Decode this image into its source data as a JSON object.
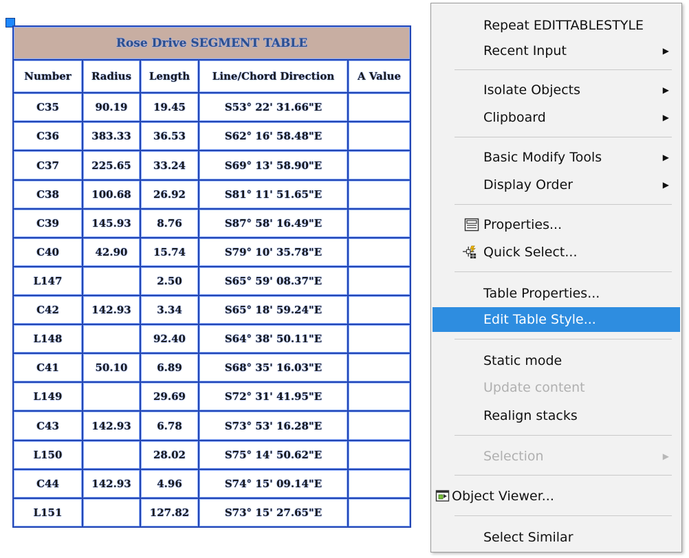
{
  "table": {
    "title": "Rose Drive SEGMENT TABLE",
    "headers": [
      "Number",
      "Radius",
      "Length",
      "Line/Chord Direction",
      "A Value"
    ],
    "rows": [
      [
        "C35",
        "90.19",
        "19.45",
        "S53° 22' 31.66\"E",
        ""
      ],
      [
        "C36",
        "383.33",
        "36.53",
        "S62° 16' 58.48\"E",
        ""
      ],
      [
        "C37",
        "225.65",
        "33.24",
        "S69° 13' 58.90\"E",
        ""
      ],
      [
        "C38",
        "100.68",
        "26.92",
        "S81° 11' 51.65\"E",
        ""
      ],
      [
        "C39",
        "145.93",
        "8.76",
        "S87° 58' 16.49\"E",
        ""
      ],
      [
        "C40",
        "42.90",
        "15.74",
        "S79° 10' 35.78\"E",
        ""
      ],
      [
        "L147",
        "",
        "2.50",
        "S65° 59' 08.37\"E",
        ""
      ],
      [
        "C42",
        "142.93",
        "3.34",
        "S65° 18' 59.24\"E",
        ""
      ],
      [
        "L148",
        "",
        "92.40",
        "S64° 38' 50.11\"E",
        ""
      ],
      [
        "C41",
        "50.10",
        "6.89",
        "S68° 35' 16.03\"E",
        ""
      ],
      [
        "L149",
        "",
        "29.69",
        "S72° 31' 41.95\"E",
        ""
      ],
      [
        "C43",
        "142.93",
        "6.78",
        "S73° 53' 16.28\"E",
        ""
      ],
      [
        "L150",
        "",
        "28.02",
        "S75° 14' 50.62\"E",
        ""
      ],
      [
        "C44",
        "142.93",
        "4.96",
        "S74° 15' 09.14\"E",
        ""
      ],
      [
        "L151",
        "",
        "127.82",
        "S73° 15' 27.65\"E",
        ""
      ]
    ]
  },
  "menu": {
    "repeat": "Repeat EDITTABLESTYLE",
    "recent_input": "Recent Input",
    "isolate_objects": "Isolate Objects",
    "clipboard": "Clipboard",
    "basic_modify_tools": "Basic Modify Tools",
    "display_order": "Display Order",
    "properties": "Properties...",
    "quick_select": "Quick Select...",
    "table_properties": "Table Properties...",
    "edit_table_style": "Edit Table Style...",
    "static_mode": "Static mode",
    "update_content": "Update content",
    "realign_stacks": "Realign stacks",
    "selection": "Selection",
    "object_viewer": "Object Viewer...",
    "select_similar": "Select Similar",
    "submenu_arrow": "▶"
  },
  "colors": {
    "highlight": "#2e8de0",
    "table_border": "#2346b3",
    "title_fill": "#c8aea2",
    "disabled_text": "#b0b0b0"
  }
}
